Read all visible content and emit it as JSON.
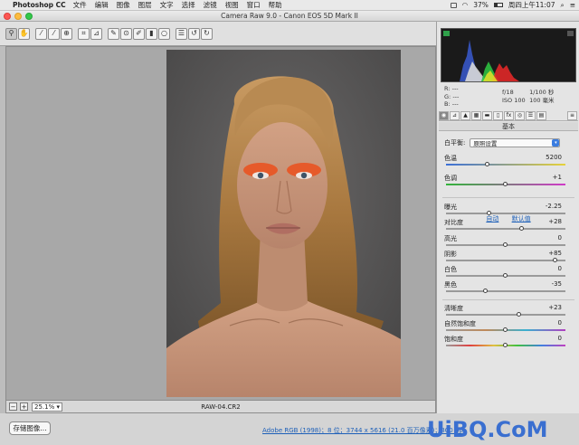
{
  "menubar": {
    "app": "Photoshop CC",
    "items": [
      "文件",
      "编辑",
      "图像",
      "图层",
      "文字",
      "选择",
      "滤镜",
      "视图",
      "窗口",
      "帮助"
    ],
    "battery": "37%",
    "clock": "周四上午11:07"
  },
  "window": {
    "title": "Camera Raw 9.0 - Canon EOS 5D Mark II"
  },
  "toolbar": {
    "tools": [
      "zoom-tool",
      "hand-tool",
      "white-balance-tool",
      "color-sampler-tool",
      "targeted-adjustment-tool",
      "crop-tool",
      "straighten-tool",
      "spot-removal-tool",
      "red-eye-tool",
      "adjustment-brush-tool",
      "graduated-filter-tool",
      "radial-filter-tool",
      "preferences",
      "rotate-ccw",
      "rotate-cw"
    ]
  },
  "canvas": {
    "zoom": "25.1%",
    "filename": "RAW-04.CR2"
  },
  "footer": {
    "save_label": "存储图像...",
    "workflow": "Adobe RGB (1998)；8 位；3744 x 5616 (21.0 百万像素)；300 ppi"
  },
  "watermark": {
    "text": "UiBQ.CoM"
  },
  "readout": {
    "r": "R:",
    "g": "G:",
    "b": "B:",
    "dash": "---",
    "aperture": "f/18",
    "shutter": "1/100 秒",
    "iso": "ISO 100",
    "focal": "100 毫米"
  },
  "panel": {
    "title": "基本",
    "wb_label": "白平衡:",
    "wb_value": "原照设置",
    "auto": "自动",
    "default": "默认值",
    "sliders": [
      {
        "label": "色温",
        "value": "5200",
        "pos": 0.35
      },
      {
        "label": "色调",
        "value": "+1",
        "pos": 0.5
      },
      {
        "label": "曝光",
        "value": "-2.25",
        "pos": 0.36
      },
      {
        "label": "对比度",
        "value": "+28",
        "pos": 0.64
      },
      {
        "label": "高光",
        "value": "0",
        "pos": 0.5
      },
      {
        "label": "阴影",
        "value": "+85",
        "pos": 0.92
      },
      {
        "label": "白色",
        "value": "0",
        "pos": 0.5
      },
      {
        "label": "黑色",
        "value": "-35",
        "pos": 0.33
      },
      {
        "label": "清晰度",
        "value": "+23",
        "pos": 0.61
      },
      {
        "label": "自然饱和度",
        "value": "0",
        "pos": 0.5
      },
      {
        "label": "饱和度",
        "value": "0",
        "pos": 0.5
      }
    ]
  }
}
